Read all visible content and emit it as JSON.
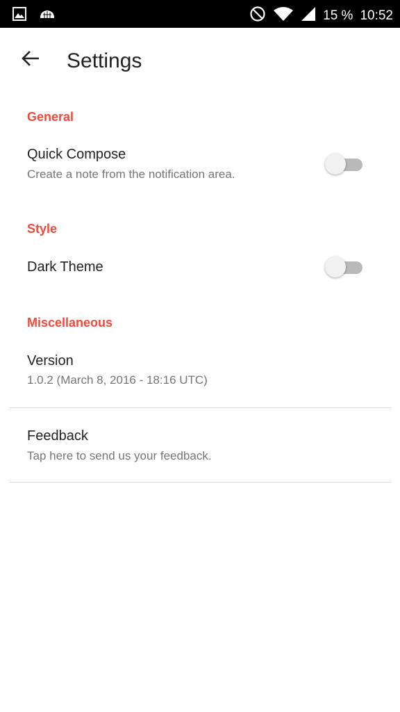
{
  "status_bar": {
    "battery": "15 %",
    "time": "10:52",
    "left_icons": [
      "image-icon",
      "cloud-icon"
    ],
    "right_icons": [
      "do-not-disturb-icon",
      "wifi-icon",
      "signal-icon"
    ]
  },
  "app_bar": {
    "title": "Settings",
    "back_icon": "arrow-back-icon"
  },
  "sections": {
    "general": {
      "header": "General",
      "quick_compose": {
        "title": "Quick Compose",
        "summary": "Create a note from the notification area.",
        "enabled": false
      }
    },
    "style": {
      "header": "Style",
      "dark_theme": {
        "title": "Dark Theme",
        "enabled": false
      }
    },
    "misc": {
      "header": "Miscellaneous",
      "version": {
        "title": "Version",
        "summary": "1.0.2 (March 8, 2016 - 18:16 UTC)"
      },
      "feedback": {
        "title": "Feedback",
        "summary": "Tap here to send us your feedback."
      }
    }
  },
  "colors": {
    "accent": "#f04a3c",
    "status_bar": "#000000",
    "background": "#ffffff"
  }
}
